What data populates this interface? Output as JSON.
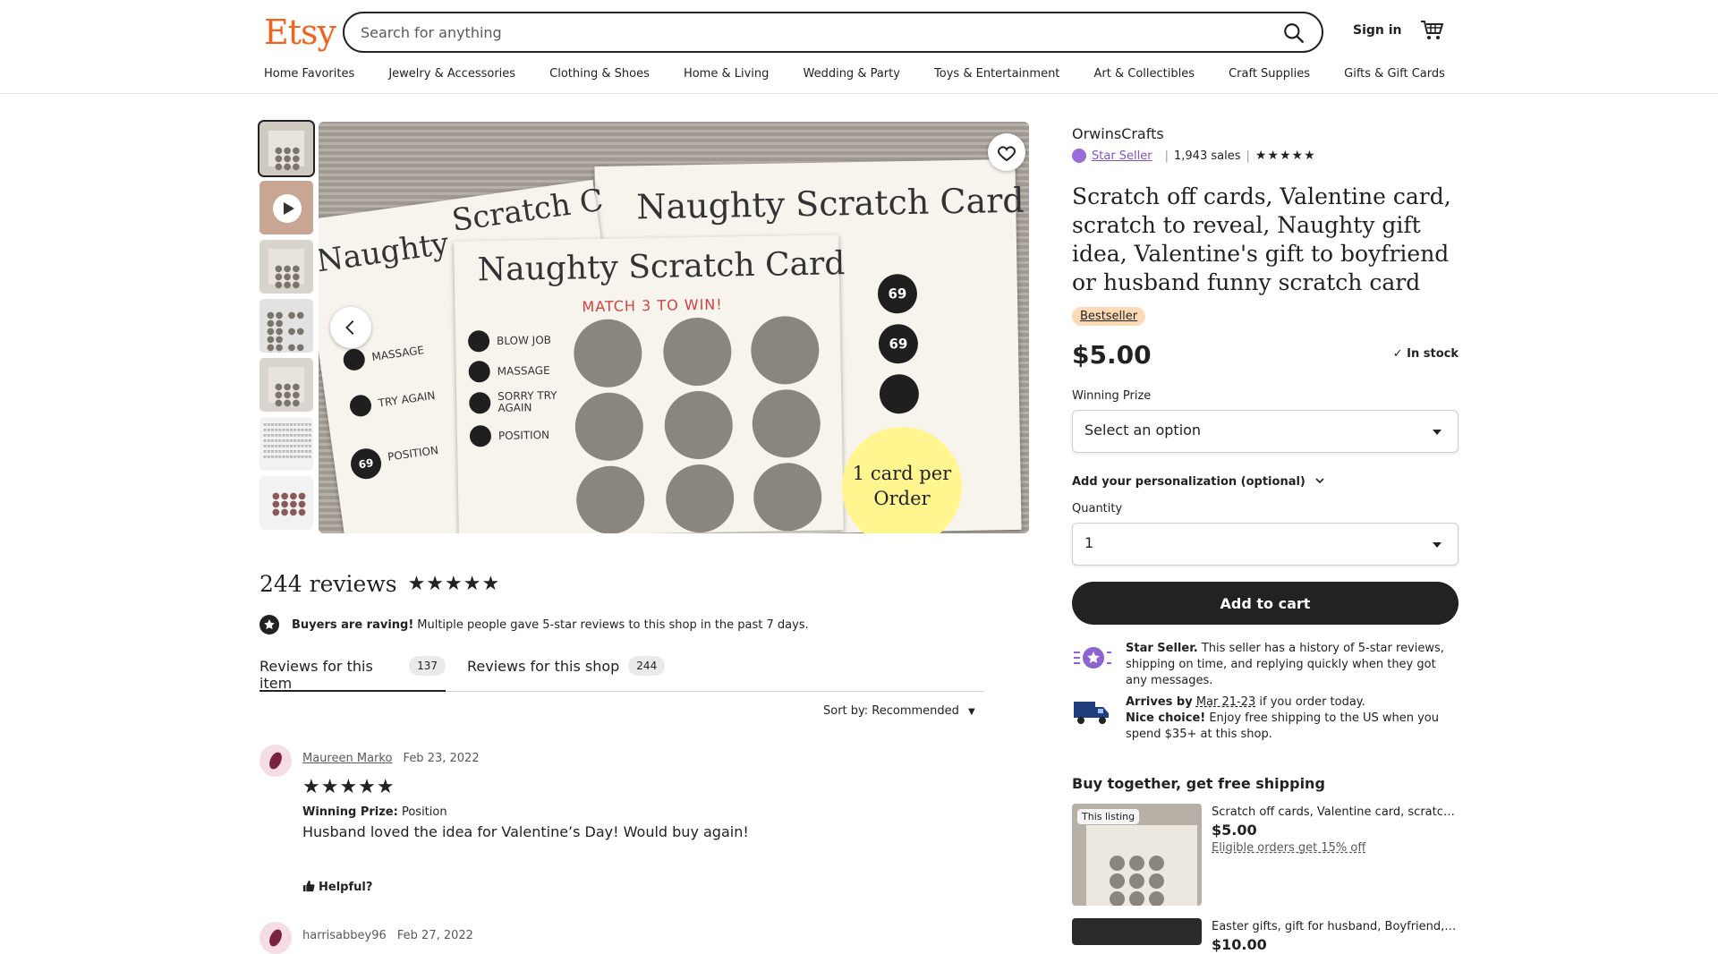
{
  "header": {
    "logo": "Etsy",
    "search_placeholder": "Search for anything",
    "sign_in": "Sign in",
    "nav": [
      "Home Favorites",
      "Jewelry & Accessories",
      "Clothing & Shoes",
      "Home & Living",
      "Wedding & Party",
      "Toys & Entertainment",
      "Art & Collectibles",
      "Craft Supplies",
      "Gifts & Gift Cards"
    ]
  },
  "gallery": {
    "card_title": "Naughty Scratch Card",
    "card_title_partial": "Scratch C",
    "match_text": "MATCH 3 TO WIN!",
    "legend": [
      "BLOW JOB",
      "MASSAGE",
      "SORRY TRY AGAIN",
      "POSITION"
    ],
    "number_tag": "69",
    "badge_line1": "1 card per",
    "badge_line2": "Order",
    "left_card_title": "Naughty",
    "left_legend": [
      "MASSAGE",
      "TRY AGAIN",
      "POSITION"
    ]
  },
  "reviews": {
    "count_label": "244 reviews",
    "raving_bold": "Buyers are raving!",
    "raving_text": "Multiple people gave 5-star reviews to this shop in the past 7 days.",
    "tab_item": "Reviews for this item",
    "tab_item_count": "137",
    "tab_shop": "Reviews for this shop",
    "tab_shop_count": "244",
    "sort": "Sort by: Recommended",
    "items": [
      {
        "author": "Maureen Marko",
        "date": "Feb 23, 2022",
        "prize_label": "Winning Prize:",
        "prize_value": "Position",
        "text": "Husband loved the idea for Valentine’s Day! Would buy again!",
        "helpful": "Helpful?"
      },
      {
        "author": "harrisabbey96",
        "date": "Feb 27, 2022"
      }
    ]
  },
  "listing": {
    "shop": "OrwinsCrafts",
    "star_seller": "Star Seller",
    "sales": "1,943 sales",
    "title": "Scratch off cards, Valentine card, scratch to reveal, Naughty gift idea, Valentine's gift to boyfriend or husband funny scratch card",
    "bestseller": "Bestseller",
    "price": "$5.00",
    "in_stock": "In stock",
    "winning_prize_label": "Winning Prize",
    "winning_prize_value": "Select an option",
    "personalization": "Add your personalization (optional)",
    "quantity_label": "Quantity",
    "quantity_value": "1",
    "add_to_cart": "Add to cart",
    "star_seller_info_bold": "Star Seller.",
    "star_seller_info": "This seller has a history of 5-star reviews, shipping on time, and replying quickly when they got any messages.",
    "arrives_bold": "Arrives by",
    "arrives_date": "Mar 21-23",
    "arrives_rest": "if you order today.",
    "nice_choice_bold": "Nice choice!",
    "nice_choice": "Enjoy free shipping to the US when you spend $35+ at this shop."
  },
  "buy_together": {
    "heading": "Buy together, get free shipping",
    "items": [
      {
        "tag": "This listing",
        "title": "Scratch off cards, Valentine card, scratch t...",
        "price": "$5.00",
        "note": "Eligible orders get 15% off"
      },
      {
        "title": "Easter gifts, gift for husband, Boyfriend, E...",
        "price": "$10.00"
      }
    ]
  },
  "colors": {
    "brand": "#f1641e",
    "star_seller": "#7e56c2",
    "bestseller_bg": "#fdd9b5",
    "cta": "#222222"
  }
}
